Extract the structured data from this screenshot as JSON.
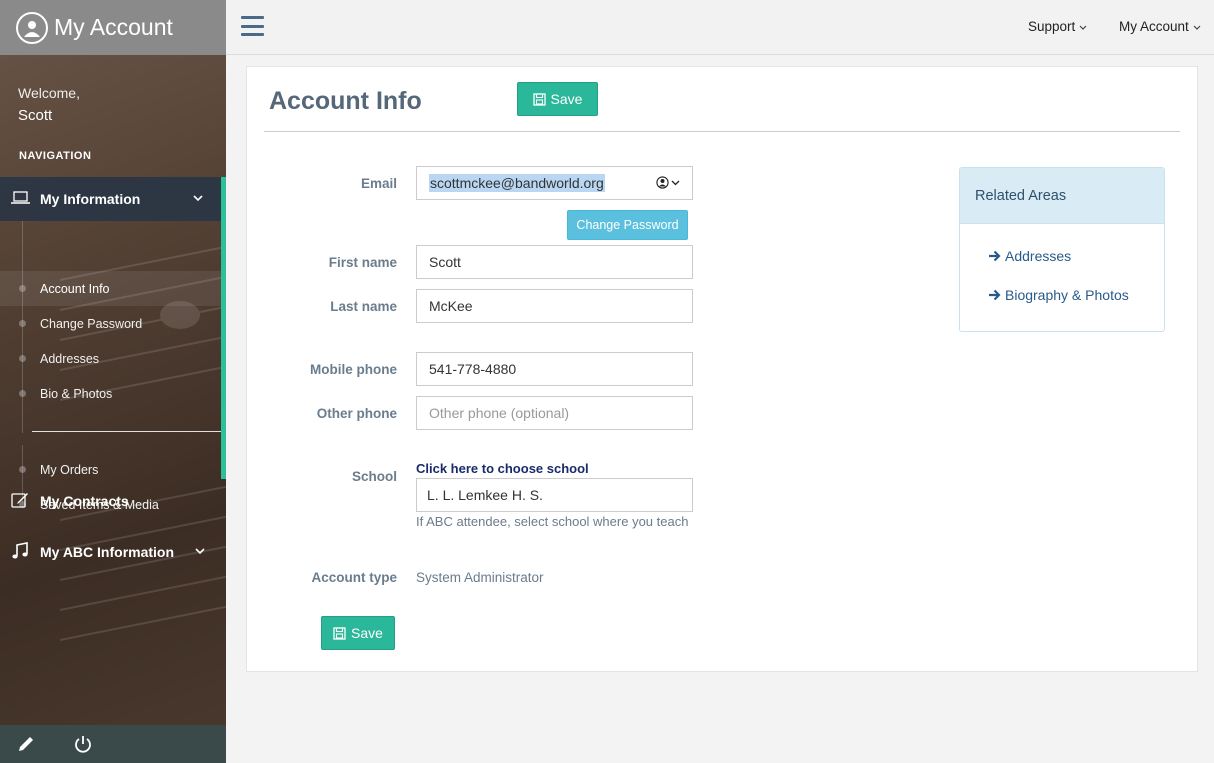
{
  "sidebar": {
    "brand_title": "My Account",
    "welcome": "Welcome,",
    "user_name": "Scott",
    "nav_heading": "NAVIGATION",
    "my_information": "My Information",
    "sub_items": [
      "Account Info",
      "Change Password",
      "Addresses",
      "Bio & Photos",
      "My Orders",
      "Saved Items & Media"
    ],
    "my_contracts": "My Contracts",
    "my_abc": "My ABC Information"
  },
  "topbar": {
    "support": "Support",
    "my_account": "My Account"
  },
  "page": {
    "title": "Account Info",
    "save_label": "Save",
    "change_password": "Change Password",
    "fields": {
      "email_label": "Email",
      "email_value": "scottmckee@bandworld.org",
      "first_name_label": "First name",
      "first_name_value": "Scott",
      "last_name_label": "Last name",
      "last_name_value": "McKee",
      "mobile_label": "Mobile phone",
      "mobile_value": "541-778-4880",
      "other_label": "Other phone",
      "other_placeholder": "Other phone (optional)",
      "school_label": "School",
      "school_link": "Click here to choose school",
      "school_value": "L. L. Lemkee H. S.",
      "school_help": "If ABC attendee, select school where you teach",
      "account_type_label": "Account type",
      "account_type_value": "System Administrator"
    }
  },
  "related": {
    "title": "Related Areas",
    "links": [
      "Addresses",
      "Biography & Photos"
    ]
  },
  "colors": {
    "accent": "#2bb89a",
    "info": "#5bc0de",
    "title": "#56677a"
  }
}
